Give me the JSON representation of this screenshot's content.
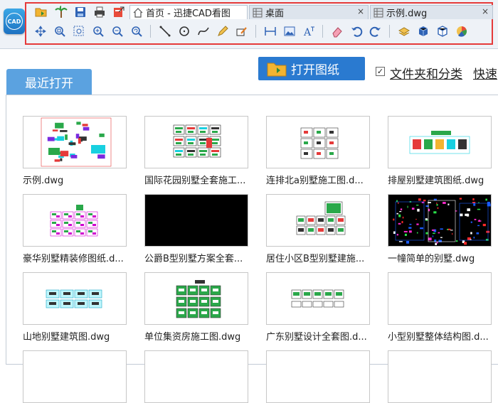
{
  "app": {
    "logo_text": "CAD"
  },
  "quick_toolbar": [
    {
      "name": "open-file-icon"
    },
    {
      "name": "palm-tree-icon"
    },
    {
      "name": "save-icon"
    },
    {
      "name": "print-icon"
    },
    {
      "name": "export-pdf-icon"
    }
  ],
  "tabs": [
    {
      "label": "首页 - 迅捷CAD看图",
      "icon": "home-icon",
      "active": true
    },
    {
      "label": "桌面",
      "icon": "grid-icon",
      "active": false,
      "close": "×"
    },
    {
      "label": "示例.dwg",
      "icon": "grid-icon",
      "active": false,
      "close": "×"
    }
  ],
  "tools": [
    {
      "name": "pan-icon"
    },
    {
      "name": "zoom-window-icon"
    },
    {
      "name": "zoom-extents-icon"
    },
    {
      "name": "zoom-in-icon"
    },
    {
      "name": "zoom-out-icon"
    },
    {
      "name": "zoom-previous-icon"
    },
    {
      "name": "line-icon"
    },
    {
      "name": "circle-icon"
    },
    {
      "name": "curve-icon"
    },
    {
      "name": "pencil-icon"
    },
    {
      "name": "revision-cloud-icon"
    },
    {
      "name": "measure-icon"
    },
    {
      "name": "image-icon"
    },
    {
      "name": "text-icon"
    },
    {
      "name": "eraser-icon"
    },
    {
      "name": "undo-icon"
    },
    {
      "name": "redo-icon"
    },
    {
      "name": "layers-icon"
    },
    {
      "name": "cube-icon"
    },
    {
      "name": "3d-view-icon"
    },
    {
      "name": "color-wheel-icon"
    }
  ],
  "main": {
    "open_button": "打开图纸",
    "folder_checkbox": {
      "label": "文件夹和分类",
      "checked": true,
      "mark": "✓"
    },
    "quick_link": "快速",
    "recent_tab": "最近打开"
  },
  "files": [
    {
      "name": "示例.dwg",
      "style": "sample"
    },
    {
      "name": "国际花园别墅全套施工...",
      "style": "sheets"
    },
    {
      "name": "连排北a别墅施工图.d...",
      "style": "sparse"
    },
    {
      "name": "排屋别墅建筑图纸.dwg",
      "style": "strip"
    },
    {
      "name": "豪华别墅精装修图纸.d...",
      "style": "magenta"
    },
    {
      "name": "公爵B型别墅方案全套...",
      "style": "black"
    },
    {
      "name": "居住小区B型别墅建施...",
      "style": "cluster"
    },
    {
      "name": "一幢简单的别墅.dwg",
      "style": "darkplan"
    },
    {
      "name": "山地别墅建筑图.dwg",
      "style": "cyan"
    },
    {
      "name": "单位集资房施工图.dwg",
      "style": "green"
    },
    {
      "name": "广东别墅设计全套图.d...",
      "style": "row"
    },
    {
      "name": "小型别墅整体结构图.d...",
      "style": "blank"
    }
  ],
  "colors": {
    "accent": "#2a7ad0",
    "tab_blue": "#5ba2e0",
    "highlight": "#e53a3a"
  }
}
